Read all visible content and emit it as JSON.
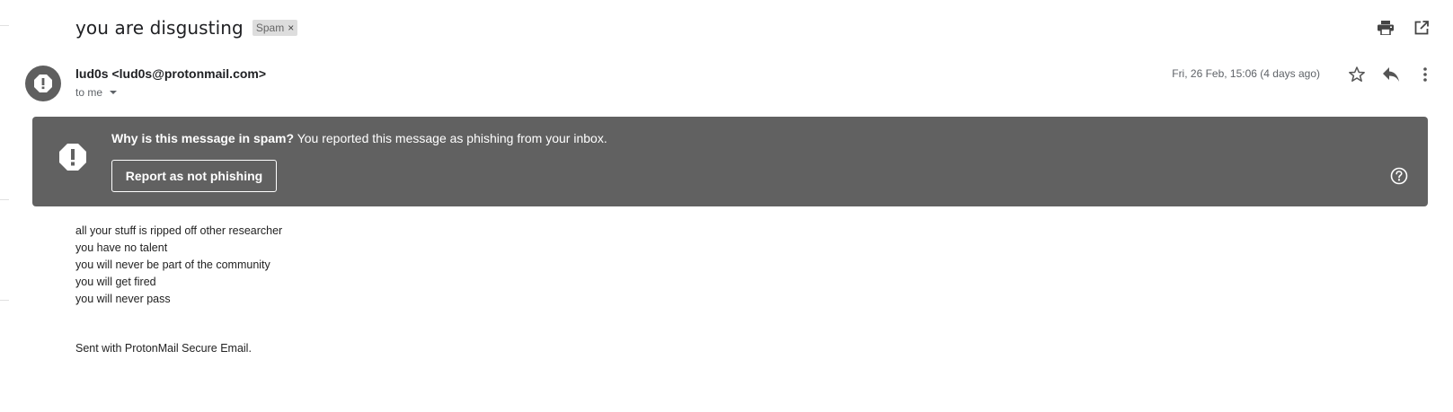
{
  "email": {
    "subject": "you are disgusting",
    "label": "Spam",
    "label_remove": "×",
    "sender": "lud0s <lud0s@protonmail.com>",
    "recipient": "to me",
    "date": "Fri, 26 Feb, 15:06 (4 days ago)",
    "body_lines": [
      "all your stuff is ripped off other researcher",
      "you have no talent",
      "you will never be part of the community",
      "you will get fired",
      "you will never pass"
    ],
    "signature": "Sent with ProtonMail Secure Email."
  },
  "spam_banner": {
    "question": "Why is this message in spam?",
    "reason": " You reported this message as phishing from your inbox.",
    "button_label": "Report as not phishing"
  },
  "icons": {
    "print": "print-icon",
    "open_new_window": "open-in-new-window-icon",
    "star": "star-icon",
    "reply": "reply-icon",
    "more": "more-vert-icon",
    "warning": "warning-octagon-icon",
    "help": "help-circle-icon"
  },
  "colors": {
    "banner_bg": "#616161",
    "avatar_bg": "#5f5f5f",
    "chip_bg": "#dddddd",
    "muted_text": "#5f6368"
  }
}
